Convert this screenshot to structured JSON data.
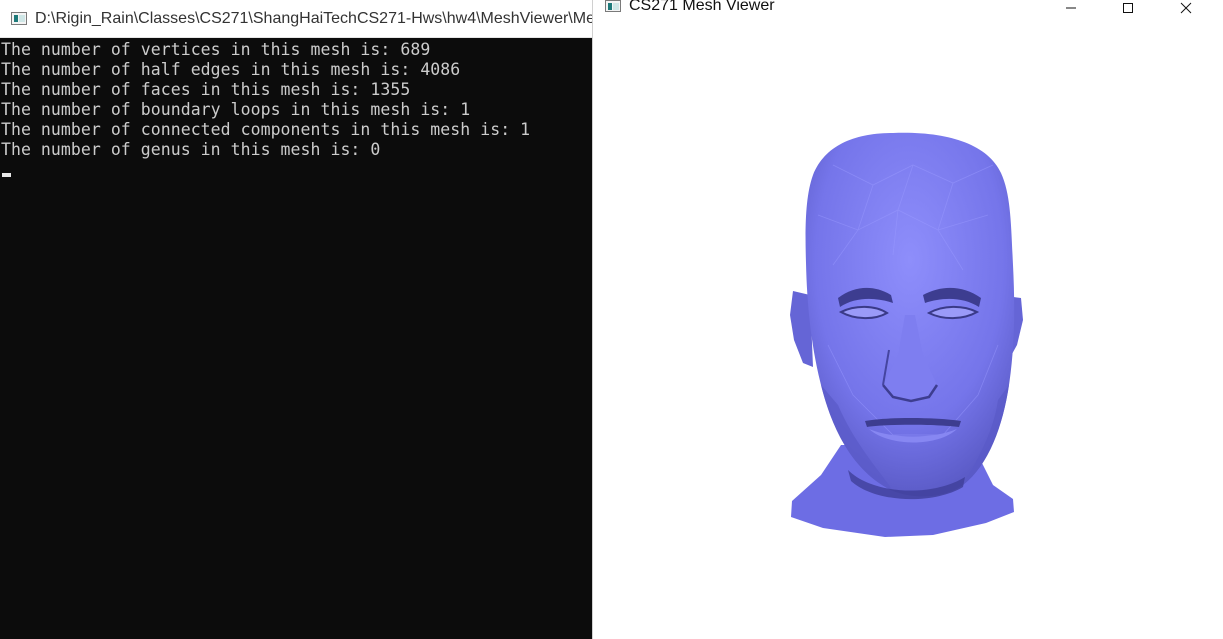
{
  "console": {
    "title": "D:\\Rigin_Rain\\Classes\\CS271\\ShangHaiTechCS271-Hws\\hw4\\MeshViewer\\Me",
    "lines": [
      "The number of vertices in this mesh is: 689",
      "The number of half edges in this mesh is: 4086",
      "The number of faces in this mesh is: 1355",
      "The number of boundary loops in this mesh is: 1",
      "The number of connected components in this mesh is: 1",
      "The number of genus in this mesh is: 0"
    ]
  },
  "viewer": {
    "title": "CS271 Mesh Viewer",
    "mesh_color": "#7b7bf0"
  }
}
